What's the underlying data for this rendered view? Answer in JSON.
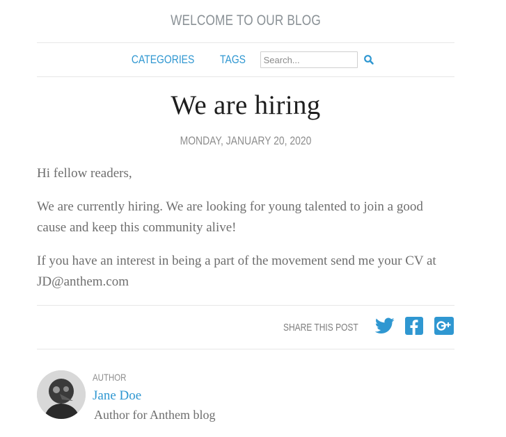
{
  "header": {
    "site_title": "WELCOME TO OUR BLOG"
  },
  "nav": {
    "categories_label": "CATEGORIES",
    "tags_label": "TAGS",
    "search_placeholder": "Search..."
  },
  "post": {
    "title": "We are hiring",
    "date": "MONDAY, JANUARY 20, 2020",
    "paragraphs": [
      "Hi fellow readers,",
      "We are currently hiring. We are looking for young talented to join a good cause and keep this community alive!",
      "If you have an interest in being a part of the movement send me your CV at JD@anthem.com"
    ]
  },
  "share": {
    "label": "SHARE THIS POST",
    "icons": [
      "twitter-icon",
      "facebook-icon",
      "google-plus-icon"
    ]
  },
  "author": {
    "caption": "AUTHOR",
    "name": "Jane Doe",
    "description": "Author for Anthem blog"
  },
  "colors": {
    "accent": "#2f97d1",
    "muted": "#8a9196",
    "title": "#1e1e1e",
    "rule": "#e6e6e6"
  }
}
